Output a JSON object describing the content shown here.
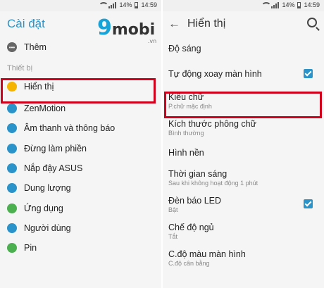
{
  "status_bar": {
    "battery": "14%",
    "time": "14:59"
  },
  "left": {
    "title": "Cài đặt",
    "more_item": {
      "label": "Thêm",
      "icon": "more-dots-icon"
    },
    "section_label": "Thiết bị",
    "items": [
      {
        "label": "Hiển thị",
        "icon": "display-icon",
        "color": "#f5b400"
      },
      {
        "label": "ZenMotion",
        "icon": "zenmotion-icon",
        "color": "#2a93c9"
      },
      {
        "label": "Âm thanh và thông báo",
        "icon": "sound-icon",
        "color": "#2a93c9"
      },
      {
        "label": "Đừng làm phiền",
        "icon": "moon-icon",
        "color": "#2a93c9"
      },
      {
        "label": "Nắp đậy ASUS",
        "icon": "cover-icon",
        "color": "#2a93c9"
      },
      {
        "label": "Dung lượng",
        "icon": "storage-icon",
        "color": "#2a93c9"
      },
      {
        "label": "Ứng dụng",
        "icon": "apps-icon",
        "color": "#4caf50"
      },
      {
        "label": "Người dùng",
        "icon": "user-icon",
        "color": "#2a93c9"
      },
      {
        "label": "Pin",
        "icon": "battery-icon",
        "color": "#4caf50"
      }
    ]
  },
  "logo": {
    "nine": "9",
    "mobi": "mobi",
    "vn": ".vn"
  },
  "right": {
    "title": "Hiển thị",
    "items": [
      {
        "title": "Độ sáng",
        "sub": ""
      },
      {
        "title": "Tự động xoay màn hình",
        "sub": "",
        "checked": true
      },
      {
        "title": "Kiểu chữ",
        "sub": "P.chữ mặc định"
      },
      {
        "title": "Kích thước phông chữ",
        "sub": "Bình thường"
      },
      {
        "title": "Hình nền",
        "sub": ""
      },
      {
        "title": "Thời gian sáng",
        "sub": "Sau khi không hoạt động 1 phút"
      },
      {
        "title": "Đèn báo LED",
        "sub": "Bật",
        "checked": true
      },
      {
        "title": "Chế độ ngủ",
        "sub": "Tắt"
      },
      {
        "title": "C.độ màu màn hình",
        "sub": "C.độ cân bằng"
      }
    ]
  },
  "colors": {
    "accent": "#2a93c9",
    "highlight": "#d0021b"
  }
}
